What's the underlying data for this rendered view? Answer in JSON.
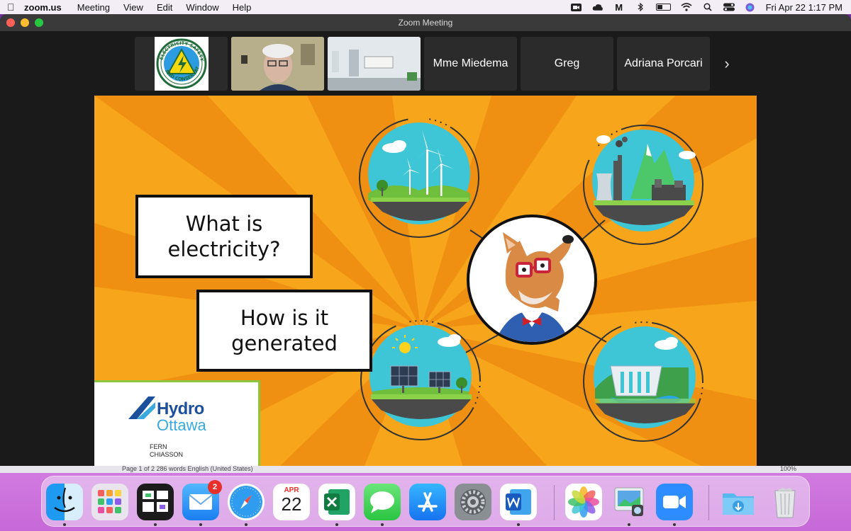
{
  "menubar": {
    "app_name": "zoom.us",
    "menus": [
      "Meeting",
      "View",
      "Edit",
      "Window",
      "Help"
    ],
    "clock": "Fri Apr 22  1:17 PM"
  },
  "window": {
    "title": "Zoom Meeting"
  },
  "participants": [
    {
      "name": "",
      "kind": "logo"
    },
    {
      "name": "",
      "kind": "video",
      "active": true
    },
    {
      "name": "",
      "kind": "video"
    },
    {
      "name": "Mme Miedema",
      "kind": "name"
    },
    {
      "name": "Greg",
      "kind": "name"
    },
    {
      "name": "Adriana Porcari",
      "kind": "name"
    }
  ],
  "participant_next_icon": "chevron-right-icon",
  "slide": {
    "question1": "What is\nelectricity?",
    "question2": "How is it\ngenerated",
    "logo_line1": "Hydro",
    "logo_line2": "Ottawa",
    "presenter_first": "FERN",
    "presenter_last": "CHIASSON"
  },
  "logo_badge_text": "ELECTRICITY SAFETY AND CONSERVATION",
  "background_doc": {
    "page_text": "Page 1 of 2   286 words   English (United States)",
    "zoom_text": "100%"
  },
  "dock": {
    "calendar_month": "APR",
    "calendar_day": "22",
    "mail_badge": "2",
    "items": [
      "finder-icon",
      "launchpad-icon",
      "mission-control-icon",
      "mail-icon",
      "safari-icon",
      "calendar-icon",
      "excel-icon",
      "messages-icon",
      "app-store-icon",
      "system-preferences-icon",
      "word-icon",
      "photos-icon",
      "preview-icon",
      "zoom-icon",
      "downloads-icon",
      "trash-icon"
    ]
  },
  "colors": {
    "slide_bg": "#f7a51a",
    "active_speaker": "#37d05b",
    "hydro_blue": "#1c4f9c",
    "hydro_light": "#3aa9dd"
  }
}
